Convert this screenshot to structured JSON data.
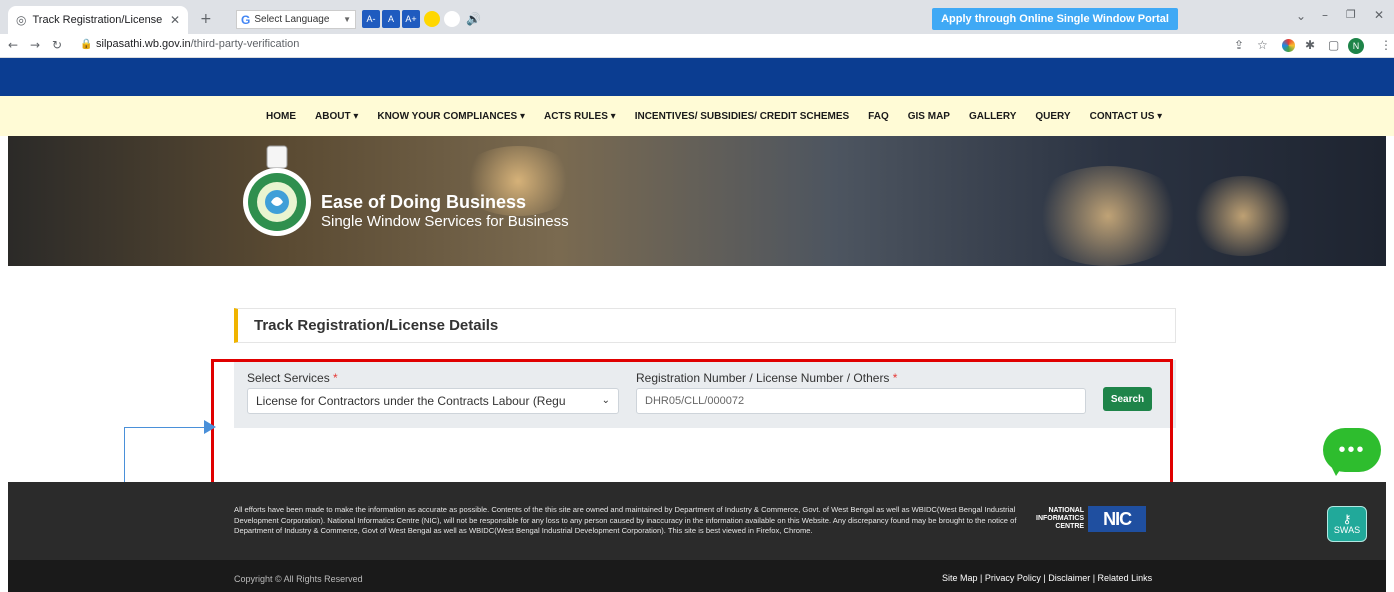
{
  "browser": {
    "tab_title": "Track Registration/License Detail",
    "url_host": "silpasathi.wb.gov.in",
    "url_path": "/third-party-verification",
    "profile_initial": "N"
  },
  "topbar": {
    "select_language": "Select Language",
    "font_decrease": "A-",
    "font_normal": "A",
    "font_increase": "A+",
    "apply_button": "Apply through Online Single Window Portal",
    "colors": {
      "bar": "#0b3d91",
      "apply": "#3fa9f5",
      "yellow_theme": "#ffd700",
      "white_theme": "#ffffff"
    }
  },
  "nav": {
    "items": [
      {
        "label": "HOME"
      },
      {
        "label": "ABOUT ▾"
      },
      {
        "label": "KNOW YOUR COMPLIANCES ▾"
      },
      {
        "label": "ACTS RULES ▾"
      },
      {
        "label": "INCENTIVES/ SUBSIDIES/ CREDIT SCHEMES"
      },
      {
        "label": "FAQ"
      },
      {
        "label": "GIS MAP"
      },
      {
        "label": "GALLERY"
      },
      {
        "label": "QUERY"
      },
      {
        "label": "CONTACT US ▾"
      }
    ]
  },
  "hero": {
    "title": "Ease of Doing Business",
    "subtitle": "Single Window Services for Business"
  },
  "page": {
    "heading": "Track Registration/License Details"
  },
  "search_form": {
    "services_label": "Select Services",
    "required_marker": "*",
    "services_selected": "License for Contractors under the Contracts Labour (Regu",
    "registration_label": "Registration Number / License Number / Others",
    "registration_value": "DHR05/CLL/000072",
    "search_button": "Search",
    "colors": {
      "panel": "#e9ecef",
      "search_button": "#1e8449",
      "required": "#e53935"
    }
  },
  "footer": {
    "disclaimer": "All efforts have been made to make the information as accurate as possible. Contents of the this site are owned and maintained by Department of Industry & Commerce, Govt. of West Bengal as well as WBIDC(West Bengal Industrial Development Corporation). National Informatics Centre (NIC), will not be responsible for any loss to any person caused by inaccuracy in the information available on this Website. Any discrepancy found may be brought to the notice of Department of Industry & Commerce, Govt of West Bengal as well as WBIDC(West Bengal Industrial Development Corporation). This site is best viewed in Firefox, Chrome.",
    "nic_wordmark_1": "NATIONAL",
    "nic_wordmark_2": "INFORMATICS",
    "nic_wordmark_3": "CENTRE",
    "nic_logo": "NIC",
    "copyright": "Copyright © All Rights Reserved",
    "links_text": "Site Map | Privacy Policy | Disclaimer | Related Links"
  },
  "widgets": {
    "chat_dots": "•••",
    "swas_label": "SWAS",
    "colors": {
      "chat": "#2ebd2e",
      "swas": "#21a99a"
    }
  },
  "annotations": {
    "highlight_color": "#e00000",
    "arrow_color": "#4a90d9"
  }
}
